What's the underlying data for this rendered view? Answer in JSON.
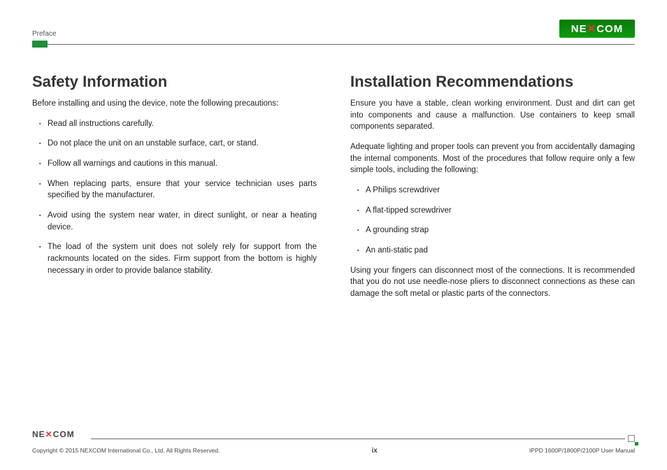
{
  "header": {
    "section_label": "Preface",
    "logo_text": "NEXCOM"
  },
  "left": {
    "heading": "Safety Information",
    "intro": "Before installing and using the device, note the following precautions:",
    "items": [
      "Read all instructions carefully.",
      "Do not place the unit on an unstable surface, cart, or stand.",
      "Follow all warnings and cautions in this manual.",
      "When replacing parts, ensure that your service technician uses parts specified by the manufacturer.",
      "Avoid using the system near water, in direct sunlight, or near a heating device.",
      "The load of the system unit does not solely rely for support from the rackmounts located on the sides. Firm support from the bottom is highly necessary in order to provide balance stability."
    ]
  },
  "right": {
    "heading": "Installation Recommendations",
    "para1": "Ensure you have a stable, clean working environment. Dust and dirt can get into components and cause a malfunction. Use containers to keep small components separated.",
    "para2": "Adequate lighting and proper tools can prevent you from accidentally damaging the internal components. Most of the procedures that follow require only a few simple tools, including the following:",
    "items": [
      "A Philips screwdriver",
      "A flat-tipped screwdriver",
      "A grounding strap",
      "An anti-static pad"
    ],
    "para3": "Using your fingers can disconnect most of the connections. It is recommended that you do not use needle-nose pliers to disconnect connections as these can damage the soft metal or plastic parts of the connectors."
  },
  "footer": {
    "logo_text": "NEXCOM",
    "copyright": "Copyright © 2015 NEXCOM International Co., Ltd. All Rights Reserved.",
    "page": "ix",
    "doc_ref": "IPPD 1600P/1800P/2100P User Manual"
  }
}
